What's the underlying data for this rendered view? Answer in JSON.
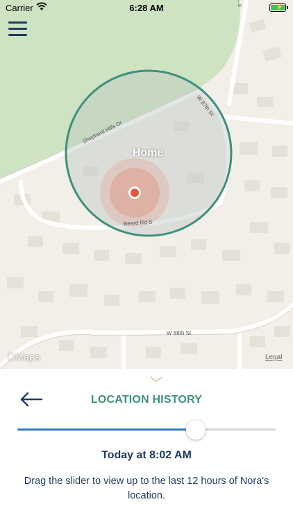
{
  "status_bar": {
    "carrier": "Carrier",
    "time": "6:28 AM",
    "battery_level": 1.0
  },
  "map": {
    "geofence_label": "Home",
    "provider_label": "Maps",
    "legal_label": "Legal",
    "roads": {
      "shepherd_hills": "Shepherd Hills Dr",
      "w_87th": "W 87th St",
      "beard_rd": "Beard Rd S",
      "w_88th": "W 88th St",
      "top_right": "...s"
    },
    "colors": {
      "geofence_stroke": "#3e8f7d",
      "location_dot": "#e8553d",
      "park": "#cde3c2",
      "land": "#f2efe9"
    }
  },
  "icons": {
    "menu": "hamburger-icon",
    "back": "arrow-left-icon",
    "chevron": "chevron-down-icon",
    "wifi": "wifi-icon",
    "battery": "battery-icon",
    "apple": "apple-logo-icon"
  },
  "panel": {
    "title": "LOCATION HISTORY",
    "slider_value": 0.69,
    "time_text": "Today at 8:02 AM",
    "description": "Drag the slider to view up to the last 12 hours of Nora's location.",
    "accent_color": "#3e8f7d",
    "slider_color": "#2f7ac4"
  }
}
